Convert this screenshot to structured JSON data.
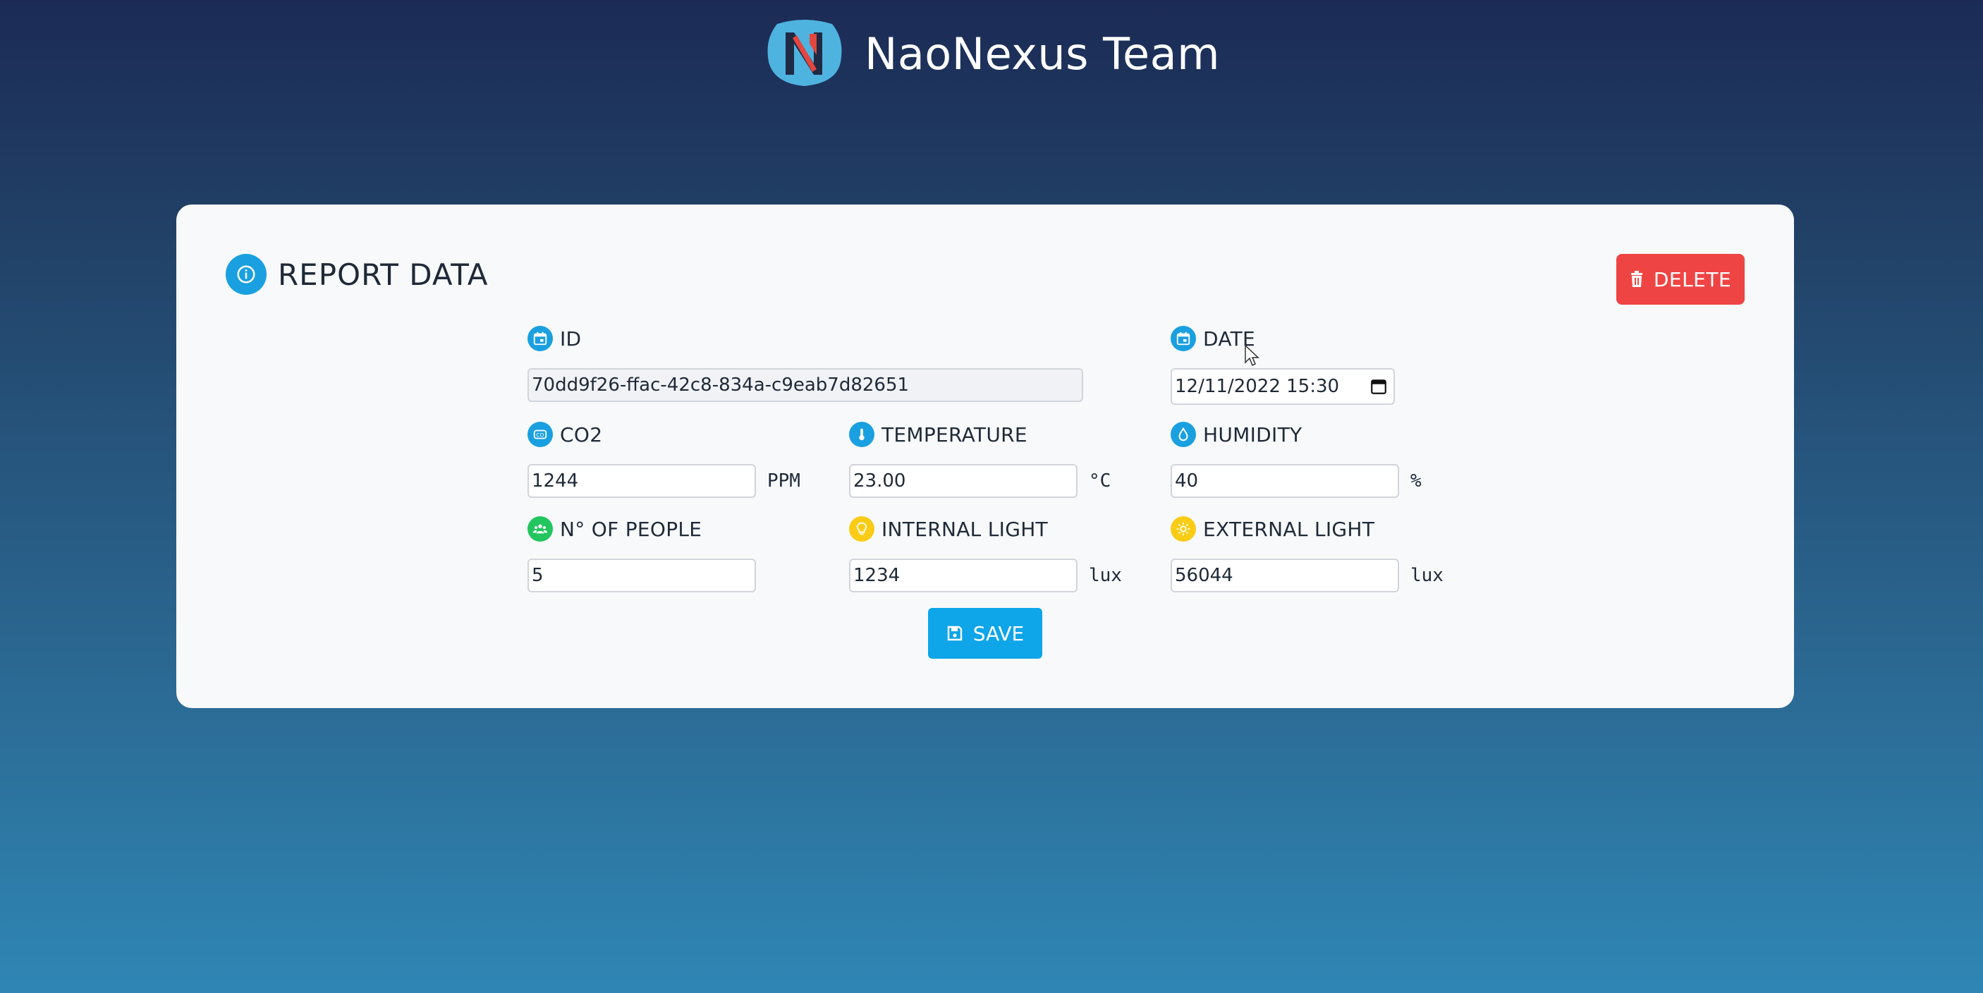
{
  "header": {
    "brand": "NaoNexus Team",
    "logo_letter": "N"
  },
  "card": {
    "title": "REPORT DATA",
    "delete_label": "DELETE",
    "save_label": "SAVE"
  },
  "fields": {
    "id": {
      "label": "ID",
      "value": "70dd9f26-ffac-42c8-834a-c9eab7d82651",
      "icon": "calendar-icon"
    },
    "date": {
      "label": "DATE",
      "value": "12/11/2022 15:30",
      "icon": "calendar-icon"
    },
    "co2": {
      "label": "CO2",
      "value": "1244",
      "unit": "PPM",
      "icon": "co2-icon"
    },
    "temperature": {
      "label": "TEMPERATURE",
      "value": "23.00",
      "unit": "°C",
      "icon": "thermometer-icon"
    },
    "humidity": {
      "label": "HUMIDITY",
      "value": "40",
      "unit": "%",
      "icon": "droplet-icon"
    },
    "people": {
      "label": "N° OF PEOPLE",
      "value": "5",
      "icon": "people-icon"
    },
    "internal_light": {
      "label": "INTERNAL LIGHT",
      "value": "1234",
      "unit": "lux",
      "icon": "lightbulb-icon"
    },
    "external_light": {
      "label": "EXTERNAL LIGHT",
      "value": "56044",
      "unit": "lux",
      "icon": "sun-icon"
    }
  },
  "colors": {
    "accent": "#1aa0e0",
    "delete": "#ef4444",
    "save": "#0ea5e9",
    "people_icon": "#22c55e",
    "light_icon": "#facc15"
  }
}
